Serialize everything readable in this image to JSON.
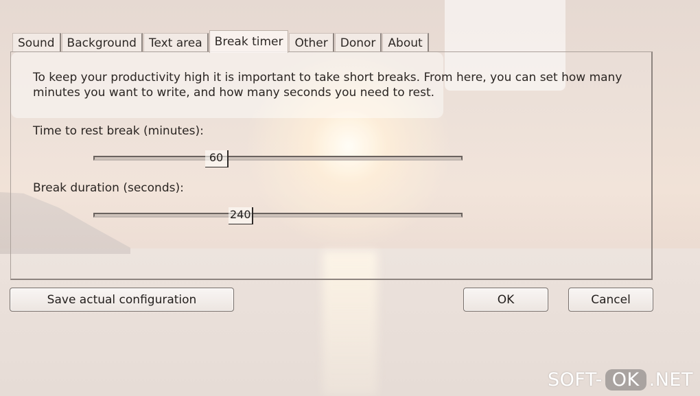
{
  "tabs": [
    "Sound",
    "Background",
    "Text area",
    "Break timer",
    "Other",
    "Donor",
    "About"
  ],
  "active_tab": "Break timer",
  "break_timer": {
    "description": "To keep your productivity high it is important to take short breaks. From here, you can set how many minutes you want to write, and how many seconds you need to rest.",
    "rest_label": "Time to rest break (minutes):",
    "rest_value": "60",
    "duration_label": "Break duration (seconds):",
    "duration_value": "240"
  },
  "buttons": {
    "save": "Save actual configuration",
    "ok": "OK",
    "cancel": "Cancel"
  },
  "watermark": {
    "left": "SOFT-",
    "mid": "OK",
    "right": ".NET"
  }
}
